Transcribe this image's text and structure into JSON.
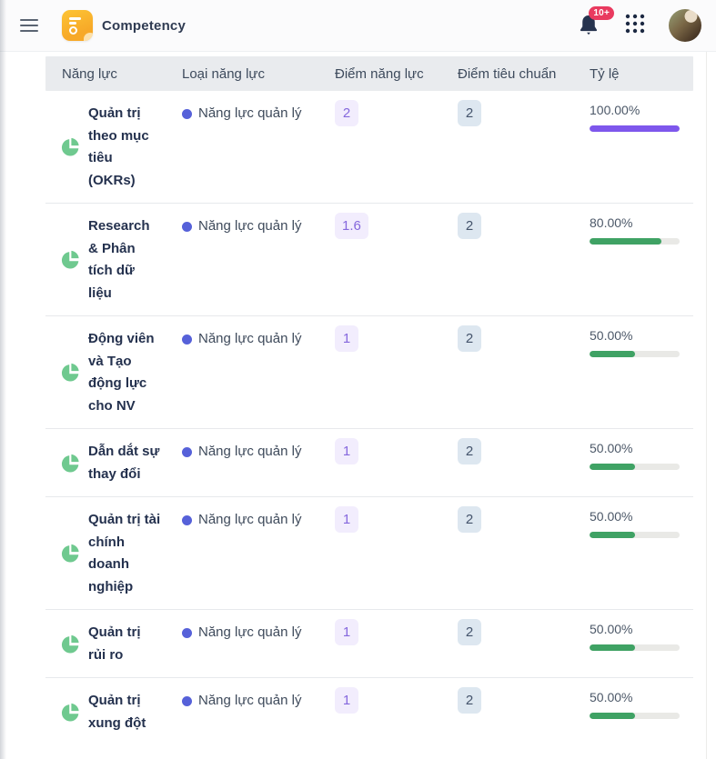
{
  "header": {
    "title": "Competency",
    "notification_count": "10+"
  },
  "icons": {
    "menu": "hamburger-icon",
    "app": "competency-app-icon",
    "bell": "notifications-bell-icon",
    "apps": "grid-apps-icon",
    "row": "pie-chart-icon"
  },
  "colors": {
    "bar_purple": "#7e57ec",
    "bar_green": "#3fa264",
    "bar_track": "#e9e9e6",
    "type_dot": "#5661d9",
    "badge_red": "#e93a5f",
    "pie_green": "#6fc98f"
  },
  "table": {
    "columns": [
      "Năng lực",
      "Loại năng lực",
      "Điểm năng lực",
      "Điểm tiêu chuẩn",
      "Tỷ lệ"
    ],
    "rows": [
      {
        "name": "Quản trị theo mục tiêu (OKRs)",
        "type": "Năng lực quản lý",
        "score": "2",
        "standard": "2",
        "ratio": "100.00%",
        "ratio_value": 100,
        "bar_color": "#7e57ec"
      },
      {
        "name": "Research & Phân tích dữ liệu",
        "type": "Năng lực quản lý",
        "score": "1.6",
        "standard": "2",
        "ratio": "80.00%",
        "ratio_value": 80,
        "bar_color": "#3fa264"
      },
      {
        "name": "Động viên và Tạo động lực cho NV",
        "type": "Năng lực quản lý",
        "score": "1",
        "standard": "2",
        "ratio": "50.00%",
        "ratio_value": 50,
        "bar_color": "#3fa264"
      },
      {
        "name": "Dẫn dắt sự thay đổi",
        "type": "Năng lực quản lý",
        "score": "1",
        "standard": "2",
        "ratio": "50.00%",
        "ratio_value": 50,
        "bar_color": "#3fa264"
      },
      {
        "name": "Quản trị tài chính doanh nghiệp",
        "type": "Năng lực quản lý",
        "score": "1",
        "standard": "2",
        "ratio": "50.00%",
        "ratio_value": 50,
        "bar_color": "#3fa264"
      },
      {
        "name": "Quản trị rủi ro",
        "type": "Năng lực quản lý",
        "score": "1",
        "standard": "2",
        "ratio": "50.00%",
        "ratio_value": 50,
        "bar_color": "#3fa264"
      },
      {
        "name": "Quản trị xung đột",
        "type": "Năng lực quản lý",
        "score": "1",
        "standard": "2",
        "ratio": "50.00%",
        "ratio_value": 50,
        "bar_color": "#3fa264"
      }
    ]
  }
}
